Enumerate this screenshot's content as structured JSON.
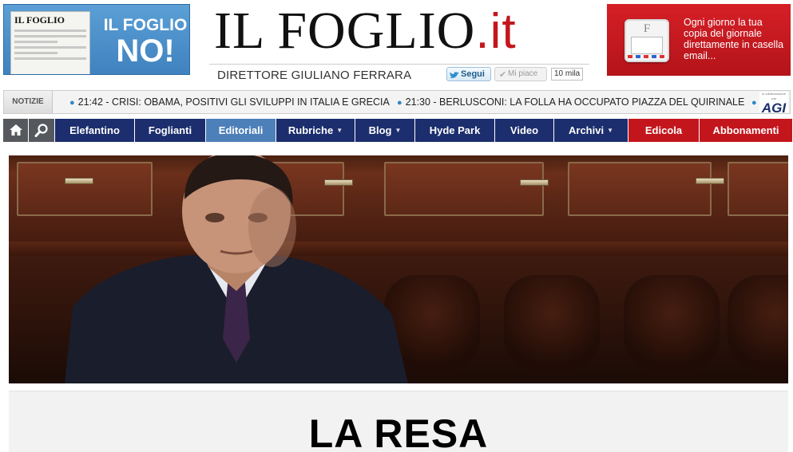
{
  "header": {
    "left_ad": {
      "line1": "IL FOGLIO",
      "line2": "NO!",
      "paper_title": "IL FOGLIO"
    },
    "logo": {
      "name": "IL FOGLIO",
      "suffix": ".it"
    },
    "director": "DIRETTORE GIULIANO FERRARA",
    "social": {
      "follow_label": "Segui",
      "like_label": "Mi piace",
      "like_count": "10 mila"
    },
    "right_ad": {
      "text": "Ogni giorno la tua copia del giornale direttamente in casella email...",
      "envelope_letter": "F"
    }
  },
  "ticker": {
    "label": "NOTIZIE",
    "items": [
      "21:42 - CRISI: OBAMA, POSITIVI GLI SVILUPPI IN ITALIA E GRECIA",
      "21:30 - BERLUSCONI: LA FOLLA HA OCCUPATO PIAZZA DEL QUIRINALE",
      ""
    ],
    "source_logo": "AGI",
    "source_caption": "in collaborazione con"
  },
  "nav": {
    "items": [
      {
        "label": "Elefantino",
        "dropdown": false
      },
      {
        "label": "Foglianti",
        "dropdown": false
      },
      {
        "label": "Editoriali",
        "dropdown": false,
        "active": true
      },
      {
        "label": "Rubriche",
        "dropdown": true
      },
      {
        "label": "Blog",
        "dropdown": true
      },
      {
        "label": "Hyde Park",
        "dropdown": false
      },
      {
        "label": "Video",
        "dropdown": false
      },
      {
        "label": "Archivi",
        "dropdown": true
      },
      {
        "label": "Edicola",
        "dropdown": false,
        "highlight": true
      },
      {
        "label": "Abbonamenti",
        "dropdown": false,
        "highlight": true
      }
    ]
  },
  "hero": {
    "headline": "LA RESA"
  },
  "colors": {
    "nav_blue": "#1c2e6e",
    "nav_active": "#4d7fb9",
    "nav_red": "#c3161c",
    "logo_red": "#c4161c",
    "ad_blue": "#4a8fcb",
    "ad_red": "#c8191f"
  },
  "icons": [
    "home-icon",
    "search-icon",
    "twitter-bird-icon",
    "check-icon",
    "envelope-icon",
    "chevron-down-icon"
  ]
}
